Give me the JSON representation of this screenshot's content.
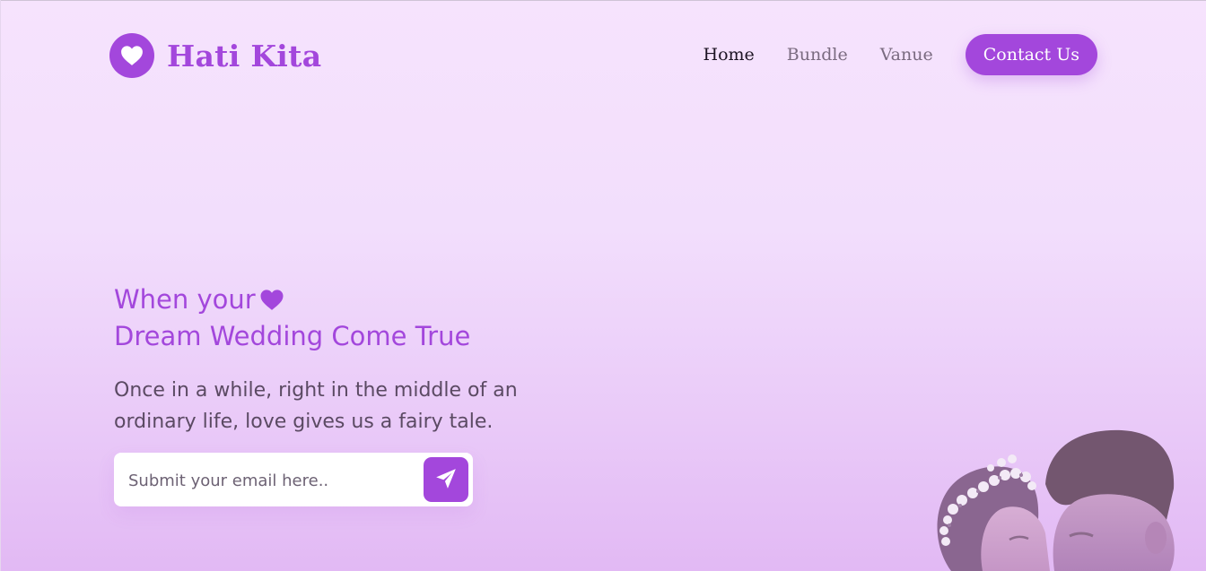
{
  "brand": {
    "name": "Hati Kita",
    "icon": "heart-icon",
    "accent_color": "#a347dc"
  },
  "nav": {
    "items": [
      {
        "label": "Home",
        "active": true
      },
      {
        "label": "Bundle",
        "active": false
      },
      {
        "label": "Vanue",
        "active": false
      }
    ],
    "cta_label": "Contact Us"
  },
  "hero": {
    "title_line1": "When your",
    "title_icon": "heart-icon",
    "title_line2": "Dream Wedding Come True",
    "description": "Once in a while, right in the middle of an ordinary life, love gives us a fairy tale.",
    "email_placeholder": "Submit your email here..",
    "email_value": "",
    "submit_icon": "paper-plane-icon",
    "photo": "wedding-couple-photo"
  }
}
